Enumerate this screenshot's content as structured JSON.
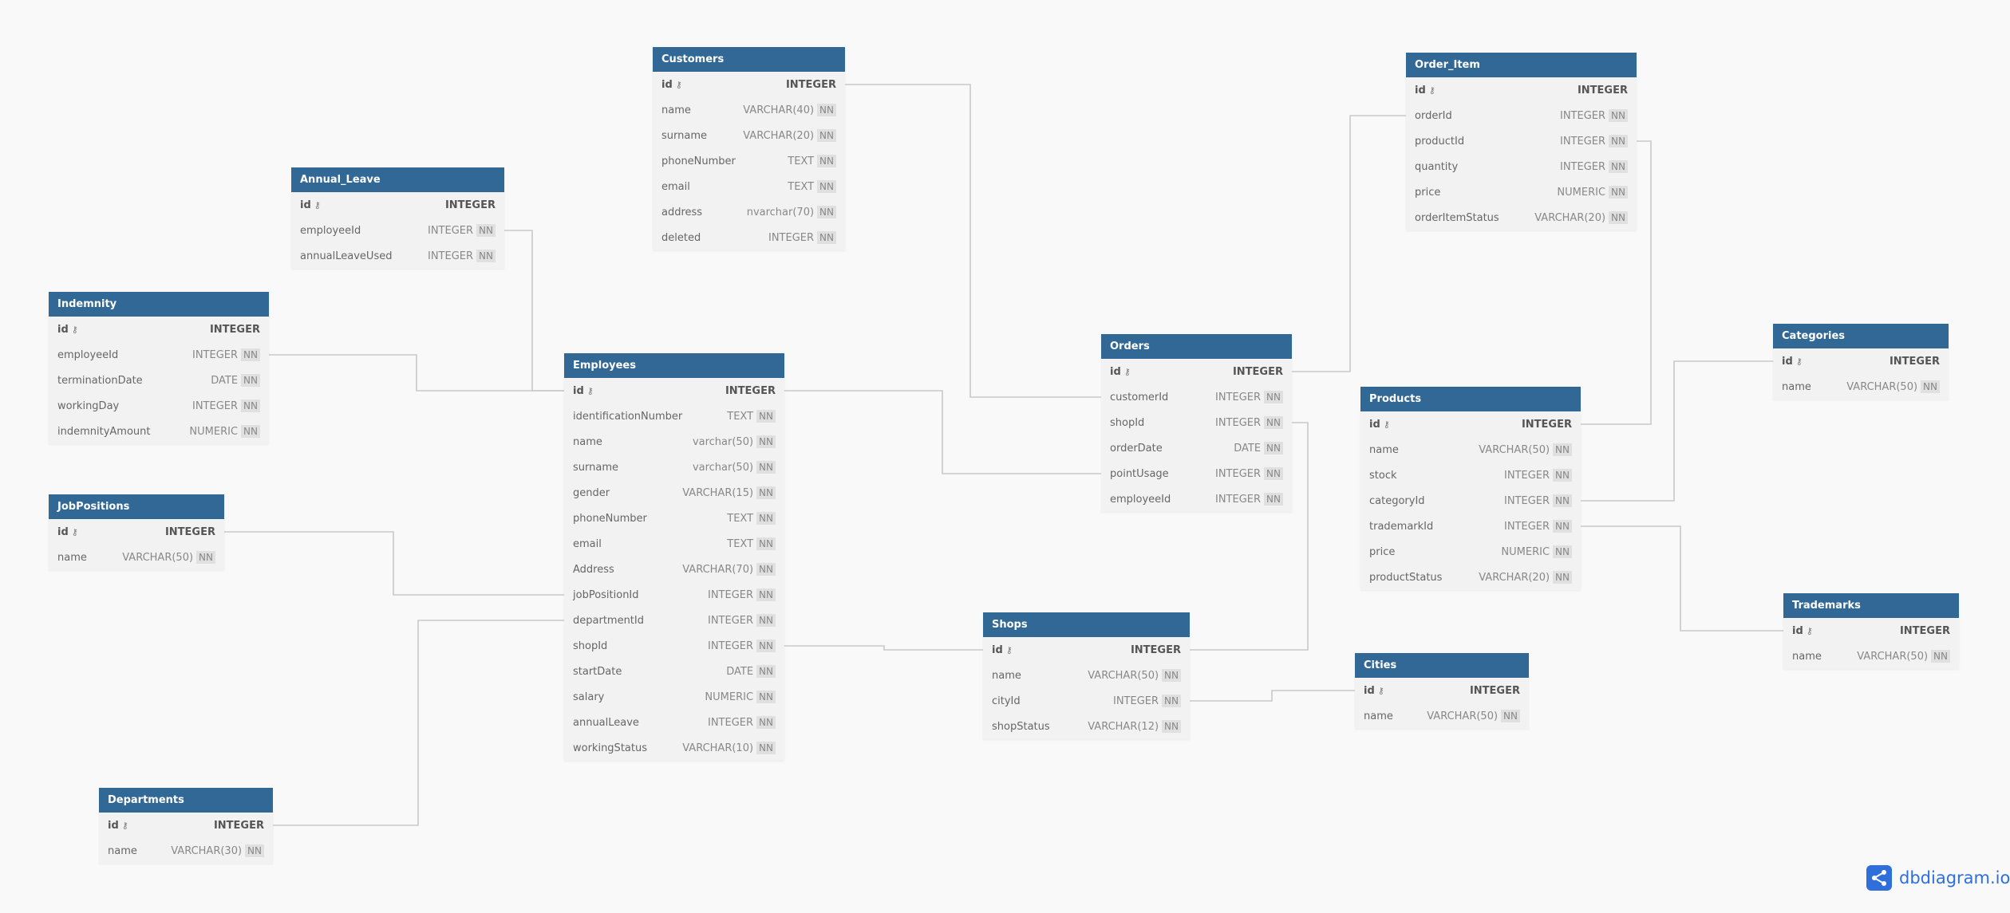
{
  "brand": {
    "name": "dbdiagram.io",
    "accent": "#2f6fdc",
    "header_color": "#316896"
  },
  "tables": [
    {
      "name": "Customers",
      "columns": [
        {
          "name": "id",
          "type": "INTEGER",
          "pk": true
        },
        {
          "name": "name",
          "type": "VARCHAR(40)",
          "nn": "NN"
        },
        {
          "name": "surname",
          "type": "VARCHAR(20)",
          "nn": "NN"
        },
        {
          "name": "phoneNumber",
          "type": "TEXT",
          "nn": "NN"
        },
        {
          "name": "email",
          "type": "TEXT",
          "nn": "NN"
        },
        {
          "name": "address",
          "type": "nvarchar(70)",
          "nn": "NN"
        },
        {
          "name": "deleted",
          "type": "INTEGER",
          "nn": "NN"
        }
      ]
    },
    {
      "name": "Annual_Leave",
      "columns": [
        {
          "name": "id",
          "type": "INTEGER",
          "pk": true
        },
        {
          "name": "employeeId",
          "type": "INTEGER",
          "nn": "NN"
        },
        {
          "name": "annualLeaveUsed",
          "type": "INTEGER",
          "nn": "NN"
        }
      ]
    },
    {
      "name": "Indemnity",
      "columns": [
        {
          "name": "id",
          "type": "INTEGER",
          "pk": true
        },
        {
          "name": "employeeId",
          "type": "INTEGER",
          "nn": "NN"
        },
        {
          "name": "terminationDate",
          "type": "DATE",
          "nn": "NN"
        },
        {
          "name": "workingDay",
          "type": "INTEGER",
          "nn": "NN"
        },
        {
          "name": "indemnityAmount",
          "type": "NUMERIC",
          "nn": "NN"
        }
      ]
    },
    {
      "name": "JobPositions",
      "columns": [
        {
          "name": "id",
          "type": "INTEGER",
          "pk": true
        },
        {
          "name": "name",
          "type": "VARCHAR(50)",
          "nn": "NN"
        }
      ]
    },
    {
      "name": "Departments",
      "columns": [
        {
          "name": "id",
          "type": "INTEGER",
          "pk": true
        },
        {
          "name": "name",
          "type": "VARCHAR(30)",
          "nn": "NN"
        }
      ]
    },
    {
      "name": "Employees",
      "columns": [
        {
          "name": "id",
          "type": "INTEGER",
          "pk": true
        },
        {
          "name": "identificationNumber",
          "type": "TEXT",
          "nn": "NN"
        },
        {
          "name": "name",
          "type": "varchar(50)",
          "nn": "NN"
        },
        {
          "name": "surname",
          "type": "varchar(50)",
          "nn": "NN"
        },
        {
          "name": "gender",
          "type": "VARCHAR(15)",
          "nn": "NN"
        },
        {
          "name": "phoneNumber",
          "type": "TEXT",
          "nn": "NN"
        },
        {
          "name": "email",
          "type": "TEXT",
          "nn": "NN"
        },
        {
          "name": "Address",
          "type": "VARCHAR(70)",
          "nn": "NN"
        },
        {
          "name": "jobPositionId",
          "type": "INTEGER",
          "nn": "NN"
        },
        {
          "name": "departmentId",
          "type": "INTEGER",
          "nn": "NN"
        },
        {
          "name": "shopId",
          "type": "INTEGER",
          "nn": "NN"
        },
        {
          "name": "startDate",
          "type": "DATE",
          "nn": "NN"
        },
        {
          "name": "salary",
          "type": "NUMERIC",
          "nn": "NN"
        },
        {
          "name": "annualLeave",
          "type": "INTEGER",
          "nn": "NN"
        },
        {
          "name": "workingStatus",
          "type": "VARCHAR(10)",
          "nn": "NN"
        }
      ]
    },
    {
      "name": "Orders",
      "columns": [
        {
          "name": "id",
          "type": "INTEGER",
          "pk": true
        },
        {
          "name": "customerId",
          "type": "INTEGER",
          "nn": "NN"
        },
        {
          "name": "shopId",
          "type": "INTEGER",
          "nn": "NN"
        },
        {
          "name": "orderDate",
          "type": "DATE",
          "nn": "NN"
        },
        {
          "name": "pointUsage",
          "type": "INTEGER",
          "nn": "NN"
        },
        {
          "name": "employeeId",
          "type": "INTEGER",
          "nn": "NN"
        }
      ]
    },
    {
      "name": "Order_Item",
      "columns": [
        {
          "name": "id",
          "type": "INTEGER",
          "pk": true
        },
        {
          "name": "orderId",
          "type": "INTEGER",
          "nn": "NN"
        },
        {
          "name": "productId",
          "type": "INTEGER",
          "nn": "NN"
        },
        {
          "name": "quantity",
          "type": "INTEGER",
          "nn": "NN"
        },
        {
          "name": "price",
          "type": "NUMERIC",
          "nn": "NN"
        },
        {
          "name": "orderItemStatus",
          "type": "VARCHAR(20)",
          "nn": "NN"
        }
      ]
    },
    {
      "name": "Products",
      "columns": [
        {
          "name": "id",
          "type": "INTEGER",
          "pk": true
        },
        {
          "name": "name",
          "type": "VARCHAR(50)",
          "nn": "NN"
        },
        {
          "name": "stock",
          "type": "INTEGER",
          "nn": "NN"
        },
        {
          "name": "categoryId",
          "type": "INTEGER",
          "nn": "NN"
        },
        {
          "name": "trademarkId",
          "type": "INTEGER",
          "nn": "NN"
        },
        {
          "name": "price",
          "type": "NUMERIC",
          "nn": "NN"
        },
        {
          "name": "productStatus",
          "type": "VARCHAR(20)",
          "nn": "NN"
        }
      ]
    },
    {
      "name": "Categories",
      "columns": [
        {
          "name": "id",
          "type": "INTEGER",
          "pk": true
        },
        {
          "name": "name",
          "type": "VARCHAR(50)",
          "nn": "NN"
        }
      ]
    },
    {
      "name": "Trademarks",
      "columns": [
        {
          "name": "id",
          "type": "INTEGER",
          "pk": true
        },
        {
          "name": "name",
          "type": "VARCHAR(50)",
          "nn": "NN"
        }
      ]
    },
    {
      "name": "Shops",
      "columns": [
        {
          "name": "id",
          "type": "INTEGER",
          "pk": true
        },
        {
          "name": "name",
          "type": "VARCHAR(50)",
          "nn": "NN"
        },
        {
          "name": "cityId",
          "type": "INTEGER",
          "nn": "NN"
        },
        {
          "name": "shopStatus",
          "type": "VARCHAR(12)",
          "nn": "NN"
        }
      ]
    },
    {
      "name": "Cities",
      "columns": [
        {
          "name": "id",
          "type": "INTEGER",
          "pk": true
        },
        {
          "name": "name",
          "type": "VARCHAR(50)",
          "nn": "NN"
        }
      ]
    }
  ]
}
